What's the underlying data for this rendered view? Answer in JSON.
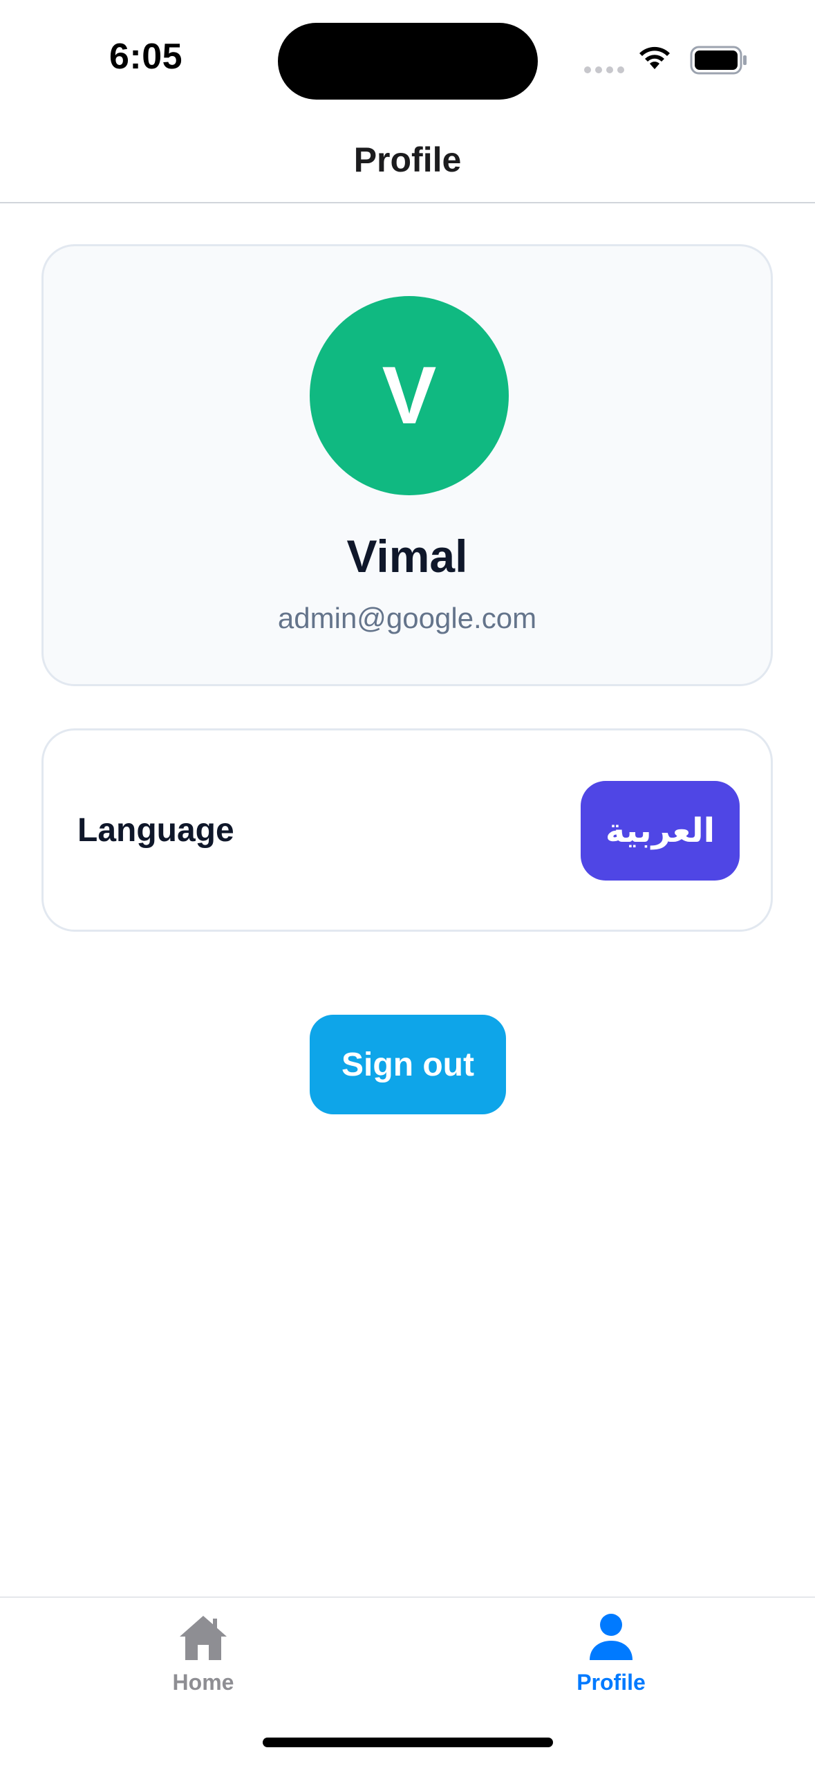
{
  "status_bar": {
    "time": "6:05"
  },
  "header": {
    "title": "Profile"
  },
  "profile": {
    "avatar_initial": "V",
    "avatar_color": "#10b981",
    "name": "Vimal",
    "email": "admin@google.com"
  },
  "settings": {
    "language_label": "Language",
    "language_button_label": "العربية",
    "language_button_color": "#4f46e5"
  },
  "actions": {
    "sign_out_label": "Sign out",
    "sign_out_color": "#0ea5e9"
  },
  "tab_bar": {
    "items": [
      {
        "label": "Home",
        "icon": "home-icon",
        "active": false
      },
      {
        "label": "Profile",
        "icon": "person-icon",
        "active": true
      }
    ],
    "active_color": "#007aff",
    "inactive_color": "#8e8e93"
  }
}
